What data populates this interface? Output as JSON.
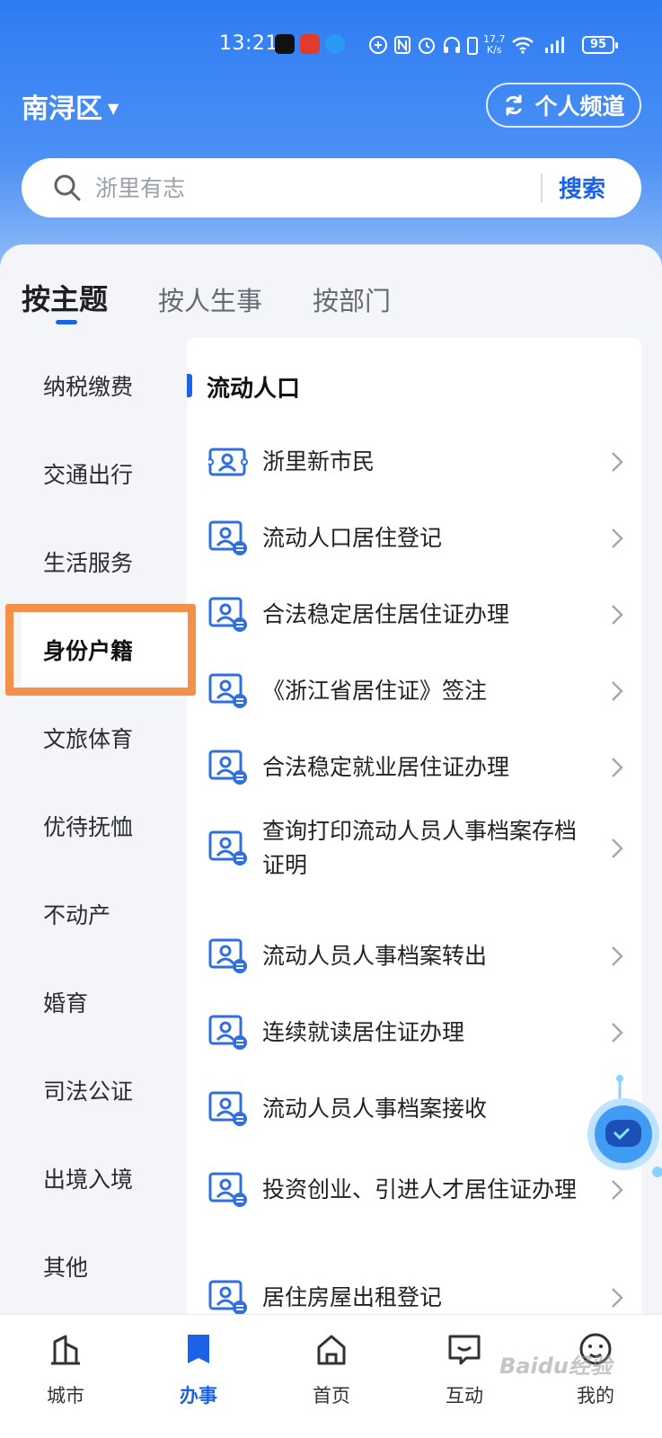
{
  "status_bar": {
    "time": "13:21",
    "net_speed": "17.7\nK/s",
    "battery": "95"
  },
  "header": {
    "region": "南浔区",
    "channel_button": "个人频道"
  },
  "search": {
    "placeholder": "浙里有志",
    "button": "搜索"
  },
  "tabs": [
    "按主题",
    "按人生事",
    "按部门"
  ],
  "categories": [
    "纳税缴费",
    "交通出行",
    "生活服务",
    "身份户籍",
    "文旅体育",
    "优待抚恤",
    "不动产",
    "婚育",
    "司法公证",
    "出境入境",
    "其他"
  ],
  "active_category": "身份户籍",
  "section": {
    "title": "流动人口",
    "items": [
      "浙里新市民",
      "流动人口居住登记",
      "合法稳定居住居住证办理",
      "《浙江省居住证》签注",
      "合法稳定就业居住证办理",
      "查询打印流动人员人事档案存档证明",
      "流动人员人事档案转出",
      "连续就读居住证办理",
      "流动人员人事档案接收",
      "投资创业、引进人才居住证办理",
      "居住房屋出租登记"
    ]
  },
  "bottom_nav": [
    "城市",
    "办事",
    "首页",
    "互动",
    "我的"
  ],
  "watermark": "Baidu经验",
  "colors": {
    "accent": "#1c62e6",
    "highlight": "#f3914a",
    "header_gradient_top": "#2f7cf2"
  }
}
